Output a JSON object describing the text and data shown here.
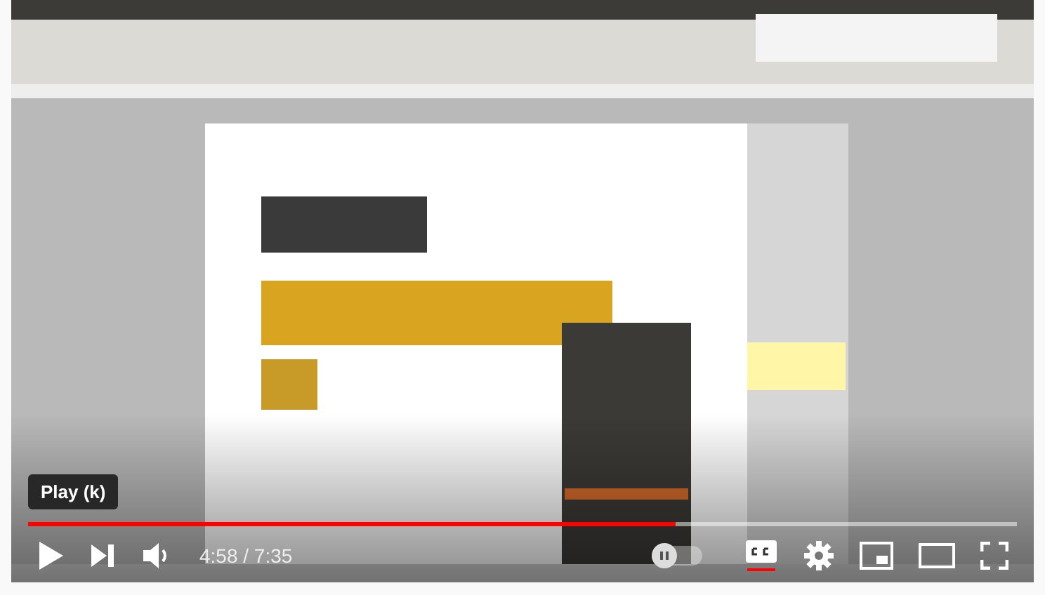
{
  "tooltip": "Play (k)",
  "progress": {
    "level": 0.655
  },
  "time": "4:58 / 7:35",
  "autoplay": {
    "on": false
  },
  "captions": {
    "on": true
  }
}
